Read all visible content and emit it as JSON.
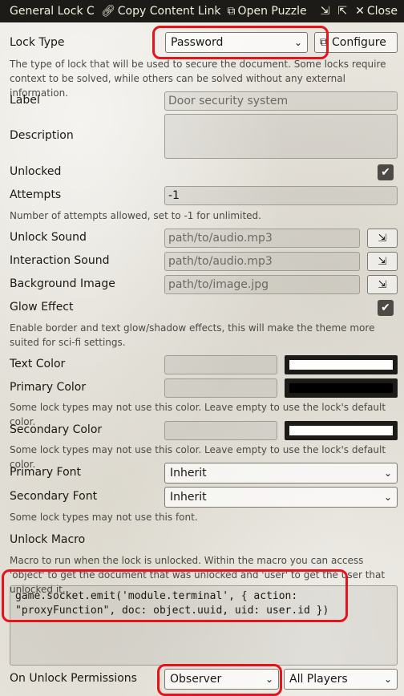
{
  "header": {
    "title": "General Lock C",
    "copy_link_label": "Copy Content Link",
    "open_puzzle_label": "Open Puzzle",
    "close_label": "Close"
  },
  "lock_type": {
    "label": "Lock Type",
    "value": "Password",
    "configure_label": "Configure",
    "hint": "The type of lock that will be used to secure the document. Some locks require context to be solved, while others can be solved without any external information."
  },
  "label_field": {
    "label": "Label",
    "placeholder": "Door security system"
  },
  "description": {
    "label": "Description"
  },
  "unlocked": {
    "label": "Unlocked",
    "checked": true
  },
  "attempts": {
    "label": "Attempts",
    "value": "-1",
    "hint": "Number of attempts allowed, set to -1 for unlimited."
  },
  "unlock_sound": {
    "label": "Unlock Sound",
    "placeholder": "path/to/audio.mp3"
  },
  "interaction_sound": {
    "label": "Interaction Sound",
    "placeholder": "path/to/audio.mp3"
  },
  "background_image": {
    "label": "Background Image",
    "placeholder": "path/to/image.jpg"
  },
  "glow_effect": {
    "label": "Glow Effect",
    "checked": true,
    "hint": "Enable border and text glow/shadow effects, this will make the theme more suited for sci-fi settings."
  },
  "text_color": {
    "label": "Text Color",
    "swatch": "#ffffff"
  },
  "primary_color": {
    "label": "Primary Color",
    "swatch": "#000000",
    "hint": "Some lock types may not use this color. Leave empty to use the lock's default color."
  },
  "secondary_color": {
    "label": "Secondary Color",
    "swatch": "#ffffff",
    "hint": "Some lock types may not use this color. Leave empty to use the lock's default color."
  },
  "primary_font": {
    "label": "Primary Font",
    "value": "Inherit"
  },
  "secondary_font": {
    "label": "Secondary Font",
    "value": "Inherit",
    "hint": "Some lock types may not use this font."
  },
  "unlock_macro": {
    "label": "Unlock Macro",
    "hint": "Macro to run when the lock is unlocked. Within the macro you can access 'object' to get the document that was unlocked and 'user' to get the user that unlocked it.",
    "code": "game.socket.emit('module.terminal', { action:\n\"proxyFunction\", doc: object.uuid, uid: user.id })"
  },
  "unlock_permissions": {
    "label": "On Unlock Permissions",
    "level": "Observer",
    "target": "All Players"
  },
  "colors": {
    "header_bg": "#1c1b18",
    "annotation": "#e8121a"
  }
}
